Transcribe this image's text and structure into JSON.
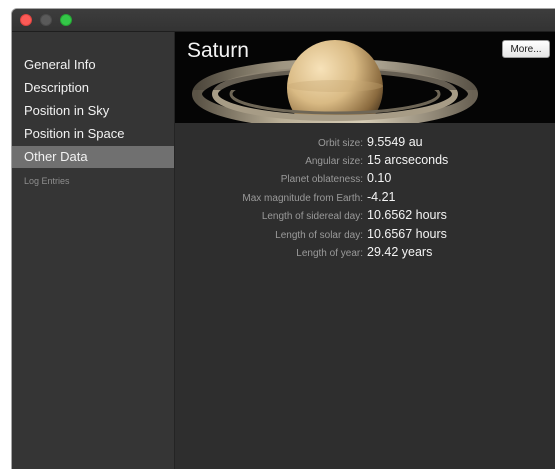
{
  "sidebar": {
    "items": [
      {
        "label": "General Info"
      },
      {
        "label": "Description"
      },
      {
        "label": "Position in Sky"
      },
      {
        "label": "Position in Space"
      },
      {
        "label": "Other Data"
      },
      {
        "label": "Log Entries"
      }
    ],
    "selected": "Other Data"
  },
  "header": {
    "title": "Saturn",
    "more_label": "More..."
  },
  "details": [
    {
      "label": "Orbit size:",
      "value": "9.5549 au"
    },
    {
      "label": "Angular size:",
      "value": "15 arcseconds"
    },
    {
      "label": "Planet oblateness:",
      "value": "0.10"
    },
    {
      "label": "Max magnitude from Earth:",
      "value": "-4.21"
    },
    {
      "label": "Length of sidereal day:",
      "value": "10.6562 hours"
    },
    {
      "label": "Length of solar day:",
      "value": "10.6567 hours"
    },
    {
      "label": "Length of year:",
      "value": "29.42 years"
    }
  ],
  "colors": {
    "window_background": "#2c2c2c",
    "sidebar_background": "#353535",
    "selected_item": "#707070",
    "header_background": "#050505",
    "close_light": "#fc5b57",
    "maximize_light": "#34c748"
  },
  "icons": {
    "planet_image": "saturn-image"
  }
}
